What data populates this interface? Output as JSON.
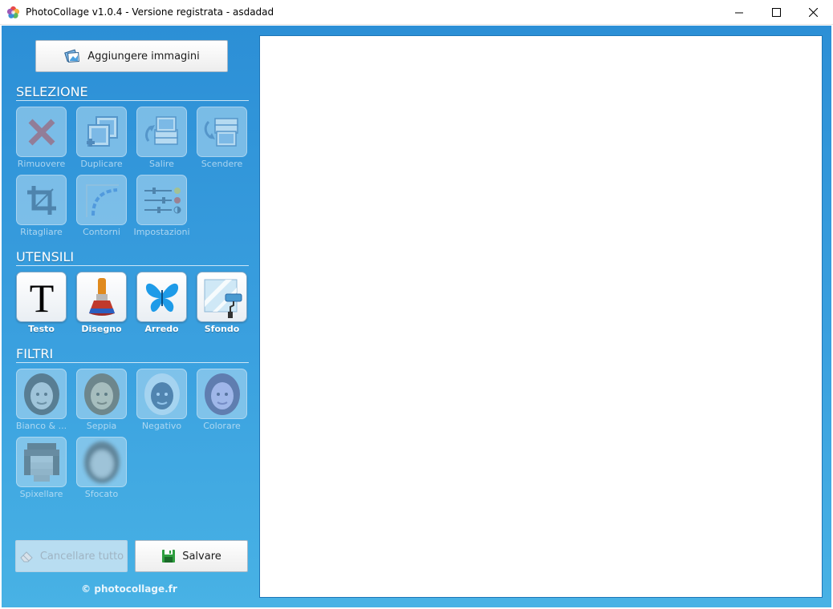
{
  "window": {
    "title": "PhotoCollage v1.0.4 - Versione registrata - asdadad"
  },
  "sidebar": {
    "add_images_label": "Aggiungere immagini",
    "sections": {
      "selection": "SELEZIONE",
      "tools": "UTENSILI",
      "filters": "FILTRI"
    },
    "selection_items": [
      {
        "label": "Rimuovere",
        "icon": "remove-x-icon",
        "enabled": false
      },
      {
        "label": "Duplicare",
        "icon": "duplicate-icon",
        "enabled": false
      },
      {
        "label": "Salire",
        "icon": "move-up-icon",
        "enabled": false
      },
      {
        "label": "Scendere",
        "icon": "move-down-icon",
        "enabled": false
      },
      {
        "label": "Ritagliare",
        "icon": "crop-icon",
        "enabled": false
      },
      {
        "label": "Contorni",
        "icon": "border-icon",
        "enabled": false
      },
      {
        "label": "Impostazioni",
        "icon": "sliders-icon",
        "enabled": false
      }
    ],
    "tool_items": [
      {
        "label": "Testo",
        "icon": "text-icon",
        "enabled": true
      },
      {
        "label": "Disegno",
        "icon": "paint-brush-icon",
        "enabled": true
      },
      {
        "label": "Arredo",
        "icon": "butterfly-icon",
        "enabled": true
      },
      {
        "label": "Sfondo",
        "icon": "paint-roller-icon",
        "enabled": true
      }
    ],
    "filter_items": [
      {
        "label": "Bianco & ...",
        "icon": "filter-bw-icon",
        "enabled": false
      },
      {
        "label": "Seppia",
        "icon": "filter-sepia-icon",
        "enabled": false
      },
      {
        "label": "Negativo",
        "icon": "filter-negative-icon",
        "enabled": false
      },
      {
        "label": "Colorare",
        "icon": "filter-colorize-icon",
        "enabled": false
      },
      {
        "label": "Spixellare",
        "icon": "filter-pixelate-icon",
        "enabled": false
      },
      {
        "label": "Sfocato",
        "icon": "filter-blur-icon",
        "enabled": false
      }
    ],
    "clear_all_label": "Cancellare tutto",
    "save_label": "Salvare",
    "footer": "© photocollage.fr"
  },
  "colors": {
    "panel_blue": "#2c8fd6",
    "panel_blue_light": "#48b2e5"
  }
}
